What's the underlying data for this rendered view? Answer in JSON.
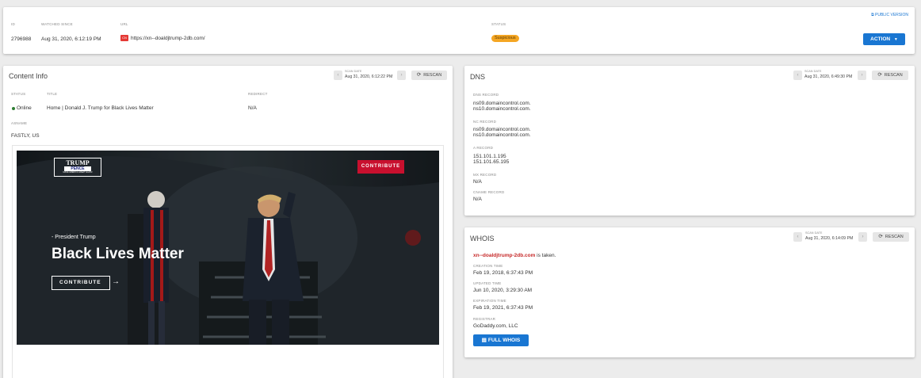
{
  "top": {
    "public_version": "PUBLIC VERSION",
    "headers": {
      "id": "ID",
      "watched_since": "WATCHED SINCE",
      "url": "URL",
      "status": "STATUS"
    },
    "id": "2796988",
    "watched_since": "Aug 31, 2020, 6:12:19 PM",
    "url": "https://xn--doaldjtrump-2db.com/",
    "url_flag_icon": "cn-flag-icon",
    "status": "Suspicious",
    "action_label": "ACTION",
    "colors": {
      "accent": "#1976d2",
      "suspicious": "#f5a623",
      "danger": "#c62828"
    }
  },
  "content_info": {
    "title": "Content Info",
    "scan_date_label": "SCAN DATE",
    "scan_date": "Aug 31, 2020, 6:12:22 PM",
    "rescan_label": "RESCAN",
    "headers": {
      "status": "STATUS",
      "title": "TITLE",
      "redirect": "REDIRECT",
      "asname": "ASNAME"
    },
    "status": "Online",
    "page_title": "Home | Donald J. Trump for Black Lives Matter",
    "redirect": "N/A",
    "asname": "FASTLY, US",
    "screenshot": {
      "logo_line1": "TRUMP",
      "logo_line2": "PENCE",
      "logo_line3": "MAKE AMERICA GREAT AGAIN!",
      "contribute_top": "CONTRIBUTE",
      "subtitle": "- President Trump",
      "headline": "Black Lives Matter",
      "contribute_button": "CONTRIBUTE"
    }
  },
  "dns": {
    "title": "DNS",
    "scan_date_label": "SCAN DATE",
    "scan_date": "Aug 31, 2020, 6:49:30 PM",
    "rescan_label": "RESCAN",
    "ns_label": "DNS RECORD",
    "ns": [
      "ns09.domaincontrol.com.",
      "ns10.domaincontrol.com."
    ],
    "nc_label": "NC RECORD",
    "nc": [
      "ns09.domaincontrol.com.",
      "ns10.domaincontrol.com."
    ],
    "a_label": "A RECORD",
    "a": [
      "151.101.1.195",
      "151.101.65.195"
    ],
    "mx_label": "MX RECORD",
    "mx": "N/A",
    "cname_label": "CNAME RECORD",
    "cname": "N/A"
  },
  "whois": {
    "title": "WHOIS",
    "scan_date_label": "SCAN DATE",
    "scan_date": "Aug 31, 2020, 6:14:09 PM",
    "rescan_label": "RESCAN",
    "domain": "xn--doaldjtrump-2db.com",
    "taken_text": "is taken.",
    "creation_label": "CREATION TIME",
    "creation": "Feb 19, 2018, 6:37:43 PM",
    "updated_label": "UPDATED TIME",
    "updated": "Jun 10, 2020, 3:29:30 AM",
    "expiration_label": "EXPIRATION TIME",
    "expiration": "Feb 19, 2021, 6:37:43 PM",
    "registrar_label": "REGISTRAR",
    "registrar": "GoDaddy.com, LLC",
    "full_whois_label": "FULL WHOIS"
  }
}
